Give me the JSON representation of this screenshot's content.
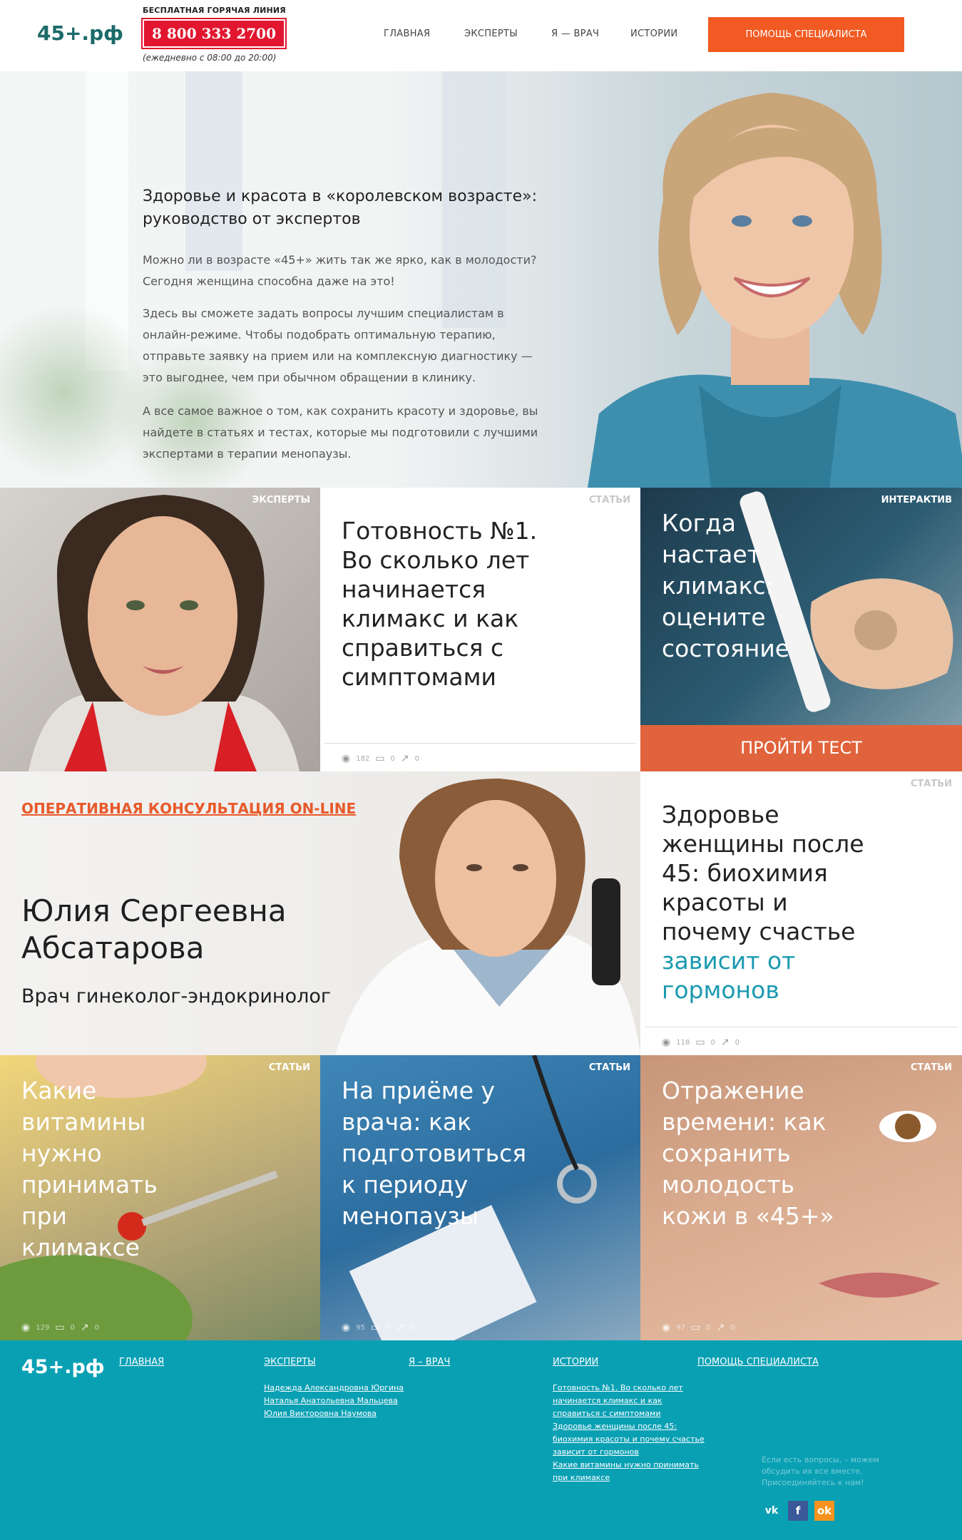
{
  "header": {
    "logo": "45+.рф",
    "hotline_label": "БЕСПЛАТНАЯ ГОРЯЧАЯ ЛИНИЯ",
    "phone": "8 800 333 2700",
    "hours": "(ежедневно с 08:00 до 20:00)",
    "nav": [
      "ГЛАВНАЯ",
      "ЭКСПЕРТЫ",
      "Я — ВРАЧ",
      "ИСТОРИИ"
    ],
    "help_button": "ПОМОЩЬ СПЕЦИАЛИСТА"
  },
  "hero": {
    "title": "Здоровье и красота в «королевском возрасте»: руководство от экспертов",
    "paragraphs": [
      "Можно ли в возрасте «45+» жить так же ярко, как в молодости? Сегодня женщина способна даже на это!",
      "Здесь вы сможете задать вопросы лучшим специалистам в онлайн-режиме. Чтобы подобрать оптимальную терапию, отправьте заявку на прием или на комплексную диагностику — это выгоднее, чем при обычном обращении в клинику.",
      "А все самое важное о том, как сохранить красоту и здоровье, вы найдете в статьях и тестах, которые мы подготовили с лучшими экспертами в терапии менопаузы."
    ]
  },
  "tiles": {
    "experts": {
      "tag": "ЭКСПЕРТЫ"
    },
    "article1": {
      "tag": "СТАТЬИ",
      "title": "Готовность №1. Во сколько лет начинается климакс и как справиться с симптомами",
      "views": "182",
      "comments": "0",
      "shares": "0"
    },
    "interactive": {
      "tag": "ИНТЕРАКТИВ",
      "title": "Когда настает климакс: оцените состояние",
      "button": "ПРОЙТИ ТЕСТ"
    },
    "consult": {
      "link": "ОПЕРАТИВНАЯ КОНСУЛЬТАЦИЯ ON-LINE",
      "name": "Юлия Сергеевна Абсатарова",
      "spec": "Врач гинеколог-эндокринолог"
    },
    "article2": {
      "tag": "СТАТЬИ",
      "title_dark": "Здоровье женщины после 45: биохимия красоты и почему счастье",
      "title_teal": "зависит от гормонов",
      "views": "118",
      "comments": "0",
      "shares": "0"
    },
    "vitamins": {
      "tag": "СТАТЬИ",
      "title": "Какие витамины нужно принимать при климаксе",
      "views": "129",
      "comments": "0",
      "shares": "0"
    },
    "doctor": {
      "tag": "СТАТЬИ",
      "title": "На приёме у врача: как подготовиться к периоду менопаузы",
      "views": "95",
      "comments": "0",
      "shares": "0"
    },
    "skin": {
      "tag": "СТАТЬИ",
      "title": "Отражение времени: как сохранить молодость кожи в «45+»",
      "views": "97",
      "comments": "0",
      "shares": "0"
    }
  },
  "footer": {
    "logo": "45+.рф",
    "main": "ГЛАВНАЯ",
    "experts": "ЭКСПЕРТЫ",
    "experts_links": [
      "Надежда Александровна Юргина",
      "Наталья Анатольевна Мальцева",
      "Юлия Викторовна Наумова"
    ],
    "doctor": "Я – ВРАЧ",
    "stories": "ИСТОРИИ",
    "stories_links": [
      "Готовность №1. Во сколько лет",
      "начинается климакс и как",
      "справиться с симптомами",
      "Здоровье женщины после 45:",
      "биохимия красоты и почему счастье",
      "зависит от гормонов",
      "Какие витамины нужно принимать",
      "при климаксе"
    ],
    "help": "ПОМОЩЬ СПЕЦИАЛИСТА",
    "note": "Если есть вопросы, – можем обсудить их все вместе. Присоединяйтесь к нам!",
    "social": [
      "vk-icon",
      "facebook-icon",
      "odnoklassniki-icon"
    ]
  },
  "colors": {
    "brand": "#1b6b6a",
    "phone_red": "#e2162f",
    "accent_orange": "#f15a22",
    "teal": "#0aa0b4",
    "test_button": "#e0633c"
  }
}
